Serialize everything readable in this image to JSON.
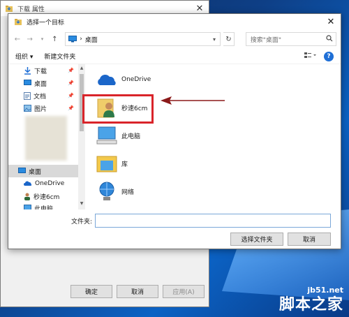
{
  "properties_window": {
    "title": "下载 属性",
    "close_glyph": "✕",
    "buttons": {
      "ok": "确定",
      "cancel": "取消",
      "apply": "应用(A)"
    }
  },
  "dialog": {
    "title": "选择一个目标",
    "close_glyph": "✕",
    "address": {
      "path": "桌面",
      "separator": "›"
    },
    "search_placeholder": "搜索\"桌面\"",
    "toolbar": {
      "organize": "组织 ▾",
      "new_folder": "新建文件夹"
    },
    "nav_items": [
      {
        "label": "下载",
        "pinned": true
      },
      {
        "label": "桌面",
        "pinned": true
      },
      {
        "label": "文档",
        "pinned": true
      },
      {
        "label": "图片",
        "pinned": true
      },
      {
        "label": "桌面",
        "selected": true
      },
      {
        "label": "OneDrive"
      },
      {
        "label": "秒速6cm"
      },
      {
        "label": "此电脑"
      }
    ],
    "content_items": [
      {
        "label": "OneDrive",
        "icon": "onedrive-cloud-icon"
      },
      {
        "label": "秒速6cm",
        "icon": "user-folder-icon"
      },
      {
        "label": "此电脑",
        "icon": "computer-icon"
      },
      {
        "label": "库",
        "icon": "library-icon"
      },
      {
        "label": "网络",
        "icon": "network-icon"
      }
    ],
    "folder_label": "文件夹:",
    "folder_value": "",
    "select_button": "选择文件夹",
    "cancel_button": "取消"
  },
  "watermark": {
    "site": "jb51.net",
    "brand": "脚本之家"
  },
  "colors": {
    "highlight": "#d9242a",
    "arrow": "#8b1a1a",
    "accent": "#1f6fd6"
  }
}
